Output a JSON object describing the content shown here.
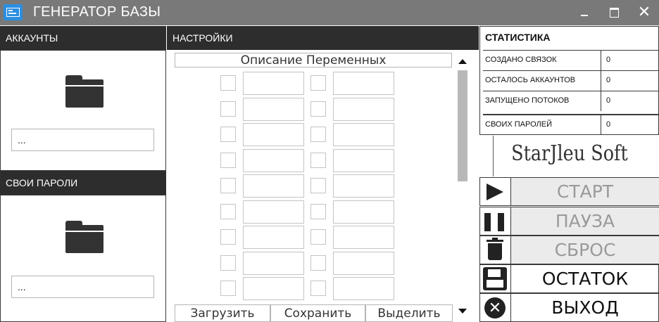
{
  "window": {
    "title": "ГЕНЕРАТОР БАЗЫ",
    "close_glyph": "✕"
  },
  "accounts": {
    "header": "АККАУНТЫ",
    "path_value": "...",
    "icon": "folder-icon"
  },
  "own_passwords": {
    "header": "СВОИ ПАРОЛИ",
    "path_value": "...",
    "icon": "folder-icon"
  },
  "settings": {
    "header": "НАСТРОЙКИ",
    "variables_header": "Описание Переменных",
    "rows": 9,
    "buttons": {
      "load": "Загрузить",
      "save": "Сохранить",
      "select_all": "Выделить Все"
    }
  },
  "stats": {
    "header": "СТАТИСТИКА",
    "rows": [
      {
        "label": "СОЗДАНО СВЯЗОК",
        "value": "0"
      },
      {
        "label": "ОСТАЛОСЬ АККАУНТОВ",
        "value": "0"
      },
      {
        "label": "ЗАПУЩЕНО ПОТОКОВ",
        "value": "0"
      },
      {
        "label": "СВОИХ ПАРОЛЕЙ",
        "value": "0"
      }
    ]
  },
  "brand": "StarJleu Soft",
  "actions": {
    "start": {
      "label": "СТАРТ",
      "icon": "play-icon"
    },
    "pause": {
      "label": "ПАУЗА",
      "icon": "pause-icon"
    },
    "reset": {
      "label": "СБРОС",
      "icon": "trash-icon"
    },
    "remainder": {
      "label": "ОСТАТОК",
      "icon": "floppy-icon"
    },
    "exit": {
      "label": "ВЫХОД",
      "icon": "close-circle-icon",
      "glyph": "✕"
    }
  }
}
